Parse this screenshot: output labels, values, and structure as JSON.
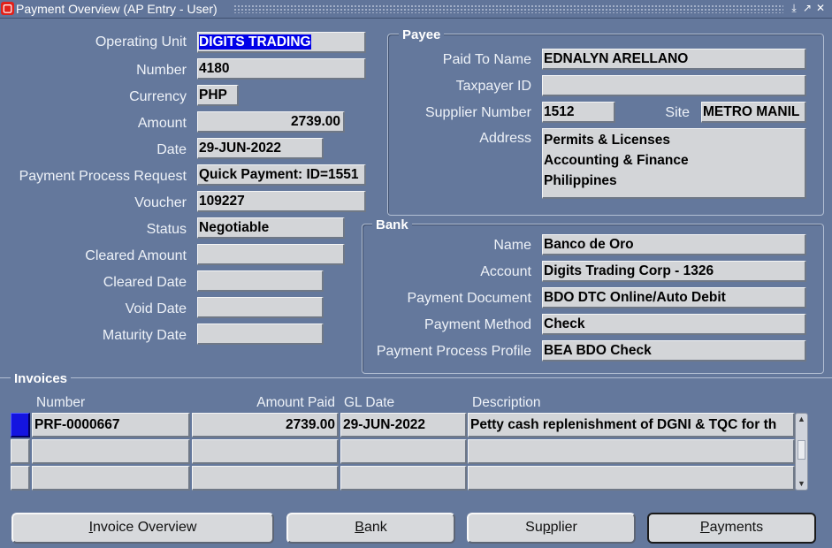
{
  "window": {
    "title": "Payment Overview (AP Entry - User)"
  },
  "payment": {
    "operating_unit_label": "Operating Unit",
    "operating_unit": "DIGITS TRADING",
    "number_label": "Number",
    "number": "4180",
    "currency_label": "Currency",
    "currency": "PHP",
    "amount_label": "Amount",
    "amount": "2739.00",
    "date_label": "Date",
    "date": "29-JUN-2022",
    "ppr_label": "Payment Process Request",
    "ppr": "Quick Payment: ID=1551",
    "voucher_label": "Voucher",
    "voucher": "109227",
    "status_label": "Status",
    "status": "Negotiable",
    "cleared_amount_label": "Cleared Amount",
    "cleared_amount": "",
    "cleared_date_label": "Cleared Date",
    "cleared_date": "",
    "void_date_label": "Void Date",
    "void_date": "",
    "maturity_date_label": "Maturity Date",
    "maturity_date": ""
  },
  "payee": {
    "section_title": "Payee",
    "paid_to_label": "Paid To Name",
    "paid_to": "EDNALYN ARELLANO",
    "taxpayer_label": "Taxpayer ID",
    "taxpayer": "",
    "supplier_number_label": "Supplier Number",
    "supplier_number": "1512",
    "site_label": "Site",
    "site": "METRO MANIL",
    "address_label": "Address",
    "address_line1": "Permits & Licenses",
    "address_line2": "Accounting & Finance",
    "address_line3": "Philippines"
  },
  "bank": {
    "section_title": "Bank",
    "name_label": "Name",
    "name": "Banco de Oro",
    "account_label": "Account",
    "account": "Digits Trading Corp - 1326",
    "document_label": "Payment Document",
    "document": "BDO DTC Online/Auto Debit",
    "method_label": "Payment Method",
    "method": "Check",
    "profile_label": "Payment Process Profile",
    "profile": "BEA BDO Check"
  },
  "invoices": {
    "section_title": "Invoices",
    "columns": {
      "number": "Number",
      "amount_paid": "Amount Paid",
      "gl_date": "GL Date",
      "description": "Description"
    },
    "rows": [
      {
        "number": "PRF-0000667",
        "amount_paid": "2739.00",
        "gl_date": "29-JUN-2022",
        "description": "Petty cash replenishment of DGNI & TQC for th"
      },
      {
        "number": "",
        "amount_paid": "",
        "gl_date": "",
        "description": ""
      },
      {
        "number": "",
        "amount_paid": "",
        "gl_date": "",
        "description": ""
      }
    ]
  },
  "buttons": {
    "invoice_overview_pre": "",
    "invoice_overview_key": "I",
    "invoice_overview_post": "nvoice Overview",
    "bank_pre": "",
    "bank_key": "B",
    "bank_post": "ank",
    "supplier_pre": "Su",
    "supplier_key": "p",
    "supplier_post": "plier",
    "payments_pre": "",
    "payments_key": "P",
    "payments_post": "ayments"
  }
}
